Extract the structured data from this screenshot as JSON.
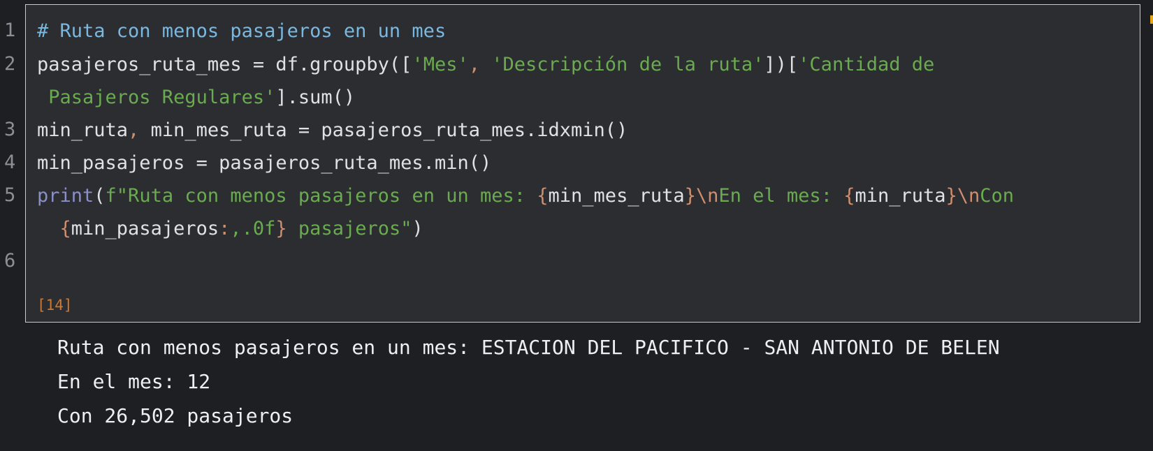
{
  "gutter": {
    "line_numbers": [
      "1",
      "2",
      "3",
      "4",
      "5",
      "6"
    ]
  },
  "cell": {
    "execution_count": "[14]",
    "code": {
      "l1": "# Ruta con menos pasajeros en un mes",
      "l2a": "pasajeros_ruta_mes = df.groupby([",
      "l2b": "'Mes'",
      "l2c": ",",
      "l2d": "'Descripción de la ruta'",
      "l2e": "])[",
      "l2f": "'Cantidad de",
      "l2g": " Pasajeros Regulares'",
      "l2h": "].sum()",
      "l3a": "min_ruta",
      "l3b": ",",
      "l3c": " min_mes_ruta = pasajeros_ruta_mes.idxmin()",
      "l4": "min_pasajeros = pasajeros_ruta_mes.min()",
      "l5a": "print",
      "l5b": "(",
      "l5c": "f\"Ruta con menos pasajeros en un mes: ",
      "l5d": "{",
      "l5e": "min_mes_ruta",
      "l5f": "}",
      "l5g": "\\n",
      "l5h": "En el mes: ",
      "l5i": "{",
      "l5j": "min_ruta",
      "l5k": "}",
      "l5l": "\\n",
      "l5m": "Con",
      "l5n": "{",
      "l5o": "min_pasajeros",
      "l5p": ":",
      "l5q": ",.0f",
      "l5r": "}",
      "l5s": " pasajeros\"",
      "l5t": ")"
    }
  },
  "output": {
    "lines": [
      "Ruta con menos pasajeros en un mes: ESTACION DEL PACIFICO - SAN ANTONIO DE BELEN",
      "En el mes: 12",
      "Con 26,502 pasajeros"
    ]
  },
  "colors": {
    "background": "#1e1f22",
    "cell_background": "#2b2d30",
    "comment": "#7ab8e0",
    "string": "#6aab50",
    "operator": "#cf8e6d",
    "keyword": "#8b8fc9",
    "execution_count": "#cc7832"
  }
}
